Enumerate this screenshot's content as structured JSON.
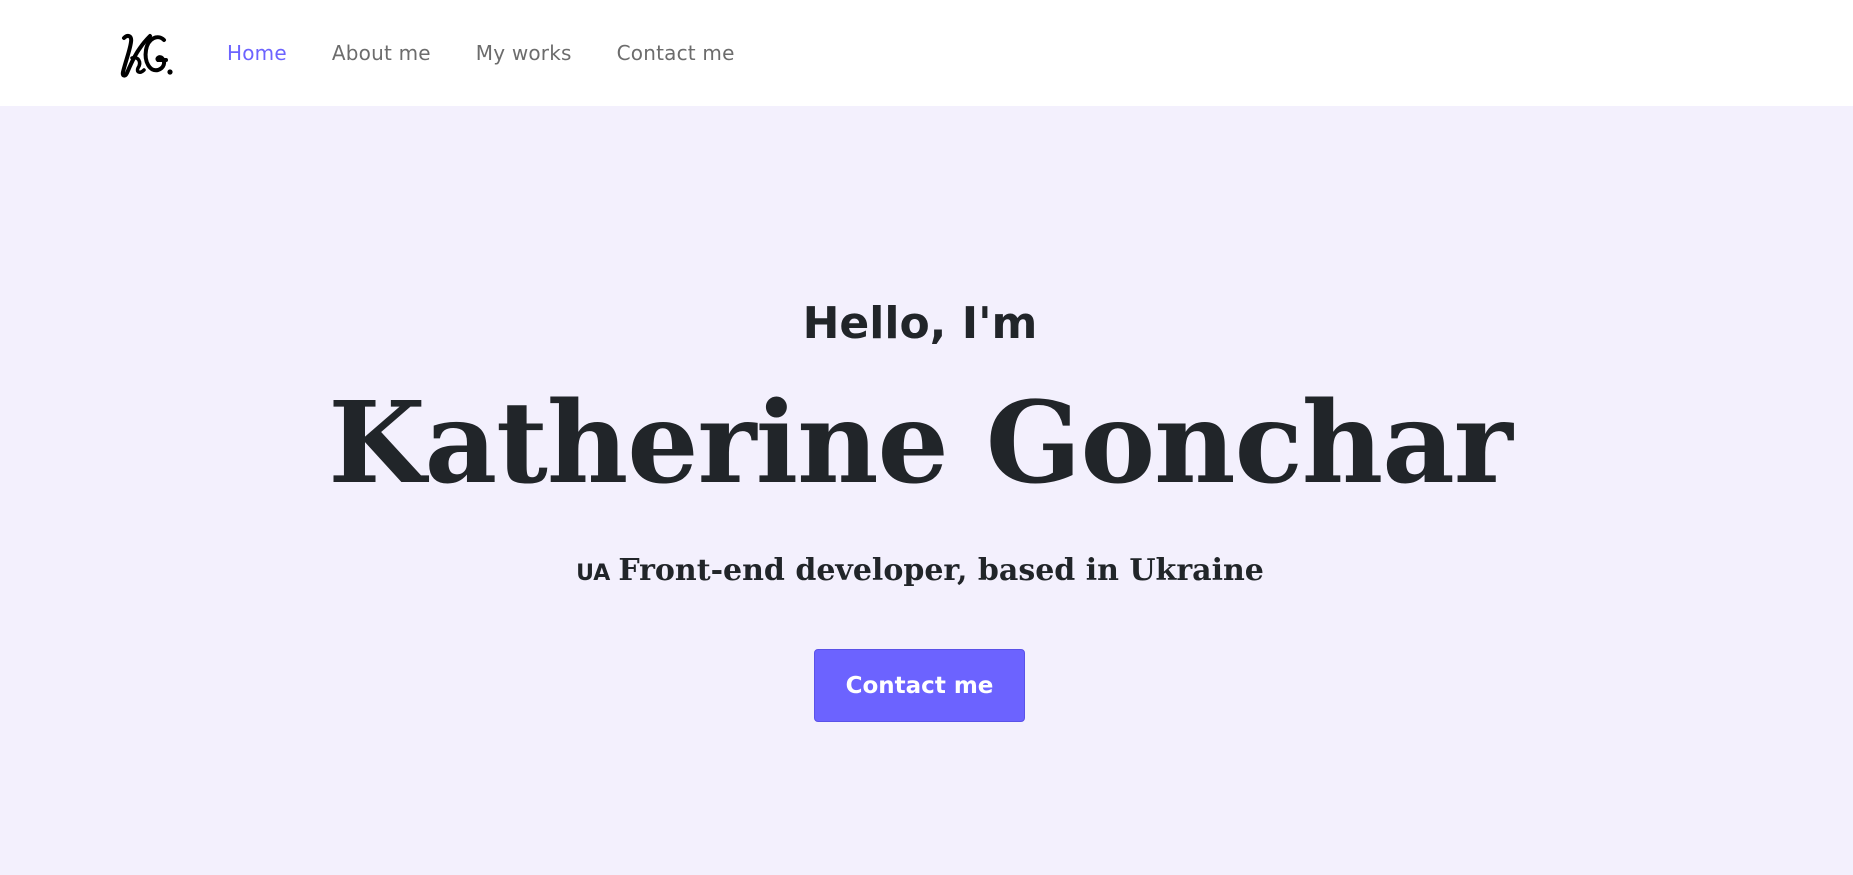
{
  "nav": {
    "logo_text": "KG.",
    "links": [
      {
        "label": "Home",
        "active": true
      },
      {
        "label": "About me",
        "active": false
      },
      {
        "label": "My works",
        "active": false
      },
      {
        "label": "Contact me",
        "active": false
      }
    ]
  },
  "hero": {
    "greeting": "Hello, I'm",
    "name": "Katherine Gonchar",
    "flag": "UA",
    "tagline": "Front-end developer, based in Ukraine",
    "cta_label": "Contact me"
  },
  "colors": {
    "accent": "#6c63ff",
    "hero_bg": "#f3f0fd",
    "text_dark": "#212529",
    "nav_text": "#6c6c6c"
  }
}
